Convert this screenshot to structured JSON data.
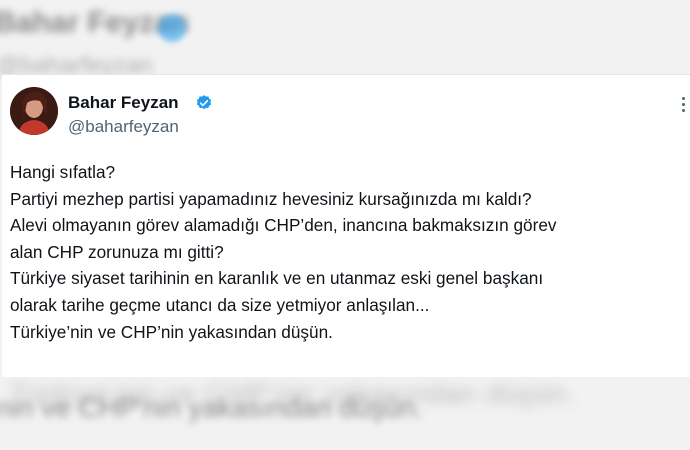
{
  "user": {
    "name": "Bahar Feyzan",
    "handle": "@baharfeyzan"
  },
  "tweet": {
    "lines": [
      "Hangi sıfatla?",
      "Partiyi mezhep partisi yapamadınız hevesiniz kursağınızda mı kaldı?",
      "Alevi olmayanın görev alamadığı CHP’den, inancına bakmaksızın görev",
      "alan CHP zorunuza mı gitti?",
      "Türkiye siyaset tarihinin en karanlık ve en utanmaz eski genel başkanı",
      "olarak tarihe geçme utancı da size yetmiyor anlaşılan...",
      "Türkiye’nin ve CHP’nin yakasından düşün."
    ]
  },
  "background": {
    "bottom_fragment": "nin ve CHP'nin yakasından düşün."
  },
  "colors": {
    "verified_blue": "#1d9bf0",
    "text": "#0f1419",
    "secondary_text": "#536471"
  },
  "icons": {
    "verified": "verified-badge-icon",
    "more": "more-options-icon"
  }
}
